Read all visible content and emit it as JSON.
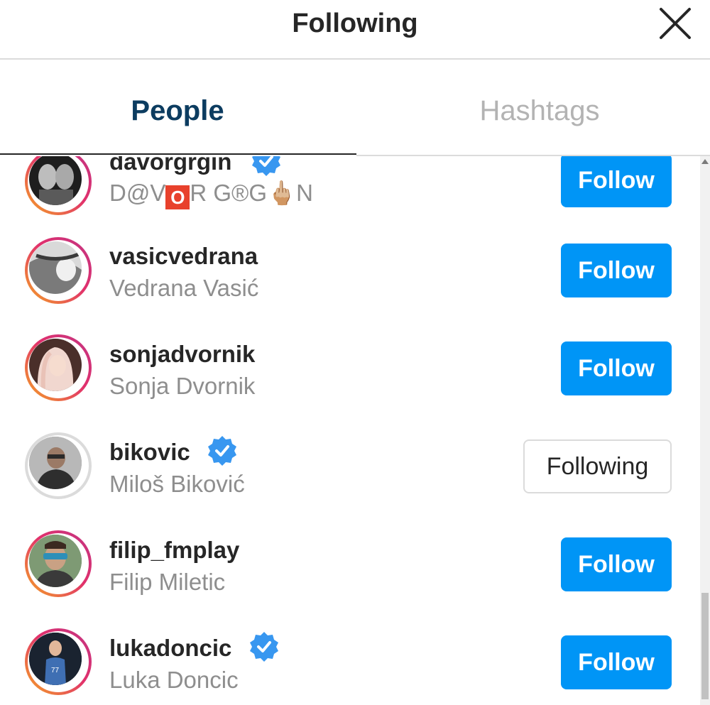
{
  "header": {
    "title": "Following",
    "close_icon": "close-icon"
  },
  "tabs": [
    {
      "label": "People",
      "active": true
    },
    {
      "label": "Hashtags",
      "active": false
    }
  ],
  "colors": {
    "follow_button": "#0095f6",
    "active_tab": "#0c3c60",
    "inactive_tab": "#b3b3b3",
    "verified": "#3897f0"
  },
  "list": [
    {
      "username": "davorgrgin",
      "fullname_parts": [
        "D@V",
        "O",
        "R G®G",
        "🖕🏼",
        "N"
      ],
      "verified": true,
      "button": "Follow"
    },
    {
      "username": "vasicvedrana",
      "fullname": "Vedrana Vasić",
      "verified": false,
      "button": "Follow"
    },
    {
      "username": "sonjadvornik",
      "fullname": "Sonja Dvornik",
      "verified": false,
      "button": "Follow"
    },
    {
      "username": "bikovic",
      "fullname": "Miloš Biković",
      "verified": true,
      "button": "Following"
    },
    {
      "username": "filip_fmplay",
      "fullname": "Filip Miletic",
      "verified": false,
      "button": "Follow"
    },
    {
      "username": "lukadoncic",
      "fullname": "Luka Doncic",
      "verified": true,
      "button": "Follow"
    }
  ]
}
